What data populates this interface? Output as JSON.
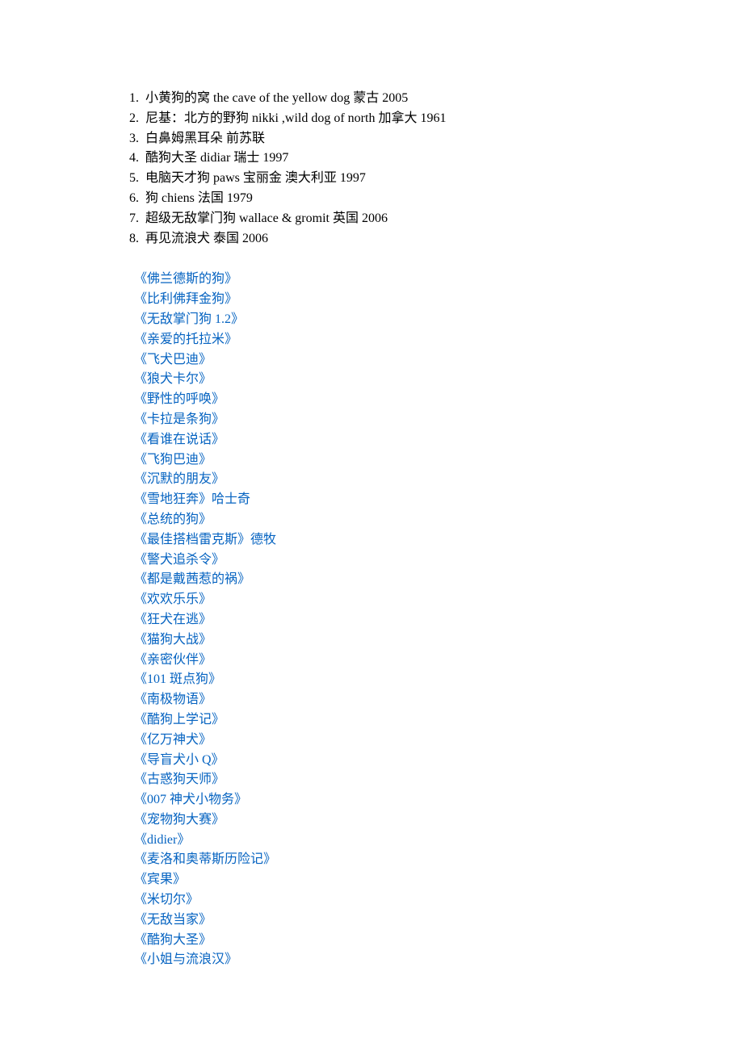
{
  "numbered": [
    {
      "n": "1.",
      "text": "小黄狗的窝 the cave of the yellow dog  蒙古  2005"
    },
    {
      "n": "2.",
      "text": "尼基：北方的野狗  nikki ,wild dog of north  加拿大  1961"
    },
    {
      "n": "3.",
      "text": "白鼻姆黑耳朵  前苏联"
    },
    {
      "n": "4.",
      "text": "酷狗大圣 didiar  瑞士  1997"
    },
    {
      "n": "5.",
      "text": "电脑天才狗 paws  宝丽金  澳大利亚  1997"
    },
    {
      "n": "6.",
      "text": "狗 chiens  法国  1979"
    },
    {
      "n": "7.",
      "text": "超级无敌掌门狗 wallace & gromit  英国  2006"
    },
    {
      "n": "8.",
      "text": "再见流浪犬              泰国 2006"
    }
  ],
  "blue_items": [
    "《佛兰德斯的狗》",
    "《比利佛拜金狗》",
    "《无敌掌门狗 1.2》",
    "《亲爱的托拉米》",
    "《飞犬巴迪》",
    "《狼犬卡尔》",
    "《野性的呼唤》",
    "《卡拉是条狗》",
    "《看谁在说话》",
    "《飞狗巴迪》",
    "《沉默的朋友》",
    "《雪地狂奔》哈士奇",
    "《总统的狗》",
    "《最佳搭档雷克斯》德牧",
    "《警犬追杀令》",
    "《都是戴茜惹的祸》",
    "《欢欢乐乐》",
    "《狂犬在逃》",
    "《猫狗大战》",
    "《亲密伙伴》",
    "《101 斑点狗》",
    "《南极物语》",
    "《酷狗上学记》",
    "《亿万神犬》",
    "《导盲犬小 Q》",
    "《古惑狗天师》",
    "《007 神犬小物务》",
    "《宠物狗大赛》",
    "《didier》",
    "《麦洛和奥蒂斯历险记》",
    "《宾果》",
    "《米切尔》",
    "《无敌当家》",
    "《酷狗大圣》",
    "《小姐与流浪汉》"
  ]
}
